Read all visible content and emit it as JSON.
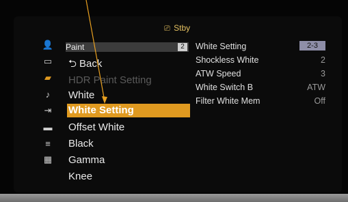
{
  "status": {
    "icon": "camera-icon",
    "label": "Stby"
  },
  "sidebar": {
    "icons": [
      "user-settings-icon",
      "camera-settings-icon",
      "paint-icon",
      "music-note-icon",
      "output-icon",
      "monitor-icon",
      "network-icon",
      "maintenance-icon"
    ]
  },
  "menu": {
    "title": "Paint",
    "page": "2",
    "items": [
      {
        "label": "Back",
        "state": "normal"
      },
      {
        "label": "HDR Paint Setting",
        "state": "disabled"
      },
      {
        "label": "White",
        "state": "normal"
      },
      {
        "label": "White Setting",
        "state": "selected"
      },
      {
        "label": "Offset White",
        "state": "normal"
      },
      {
        "label": "Black",
        "state": "normal"
      },
      {
        "label": "Gamma",
        "state": "normal"
      },
      {
        "label": "Knee",
        "state": "normal"
      }
    ]
  },
  "detail": {
    "title": "White Setting",
    "badge": "2-3",
    "rows": [
      {
        "label": "Shockless White",
        "value": "2"
      },
      {
        "label": "ATW Speed",
        "value": "3"
      },
      {
        "label": "White Switch B",
        "value": "ATW"
      },
      {
        "label": "Filter White Mem",
        "value": "Off"
      }
    ]
  },
  "colors": {
    "accent": "#e09a20",
    "pointer": "#e8a020",
    "status": "#e4c060"
  }
}
